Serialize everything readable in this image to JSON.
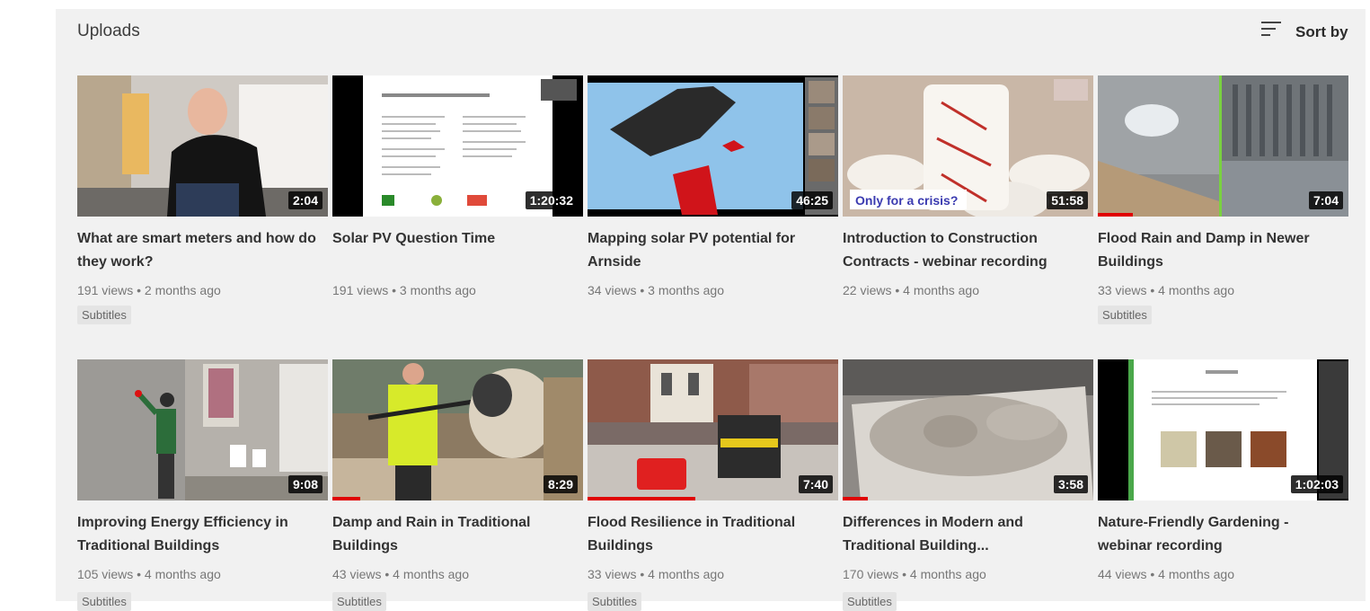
{
  "header": {
    "title": "Uploads",
    "sort_label": "Sort by"
  },
  "row1": [
    {
      "title": "What are smart meters and how do they work?",
      "duration": "2:04",
      "meta": "191 views • 2 months ago",
      "badge": "Subtitles",
      "progress": 0
    },
    {
      "title": "Solar PV Question Time",
      "duration": "1:20:32",
      "meta": "191 views • 3 months ago",
      "badge": "",
      "progress": 0
    },
    {
      "title": "Mapping solar PV potential for Arnside",
      "duration": "46:25",
      "meta": "34 views • 3 months ago",
      "badge": "",
      "progress": 0
    },
    {
      "title": "Introduction to Construction Contracts - webinar recording",
      "duration": "51:58",
      "meta": "22 views • 4 months ago",
      "badge": "",
      "progress": 0,
      "overlay_text": "Only for a crisis?"
    },
    {
      "title": "Flood Rain and Damp in Newer Buildings",
      "duration": "7:04",
      "meta": "33 views • 4 months ago",
      "badge": "Subtitles",
      "progress": 0.14
    }
  ],
  "row2": [
    {
      "title": "Improving Energy Efficiency in Traditional Buildings",
      "duration": "9:08",
      "meta": "105 views • 4 months ago",
      "badge": "Subtitles",
      "progress": 0
    },
    {
      "title": "Damp and Rain in Traditional Buildings",
      "duration": "8:29",
      "meta": "43 views • 4 months ago",
      "badge": "Subtitles",
      "progress": 0.11
    },
    {
      "title": "Flood Resilience in Traditional Buildings",
      "duration": "7:40",
      "meta": "33 views • 4 months ago",
      "badge": "Subtitles",
      "progress": 0.43
    },
    {
      "title": "Differences in Modern and Traditional Building...",
      "duration": "3:58",
      "meta": "170 views • 4 months ago",
      "badge": "Subtitles",
      "progress": 0.1
    },
    {
      "title": "Nature-Friendly Gardening - webinar recording",
      "duration": "1:02:03",
      "meta": "44 views • 4 months ago",
      "badge": "",
      "progress": 0
    }
  ],
  "colors": {
    "progress": "#e00000",
    "duration_bg": "#000000"
  }
}
